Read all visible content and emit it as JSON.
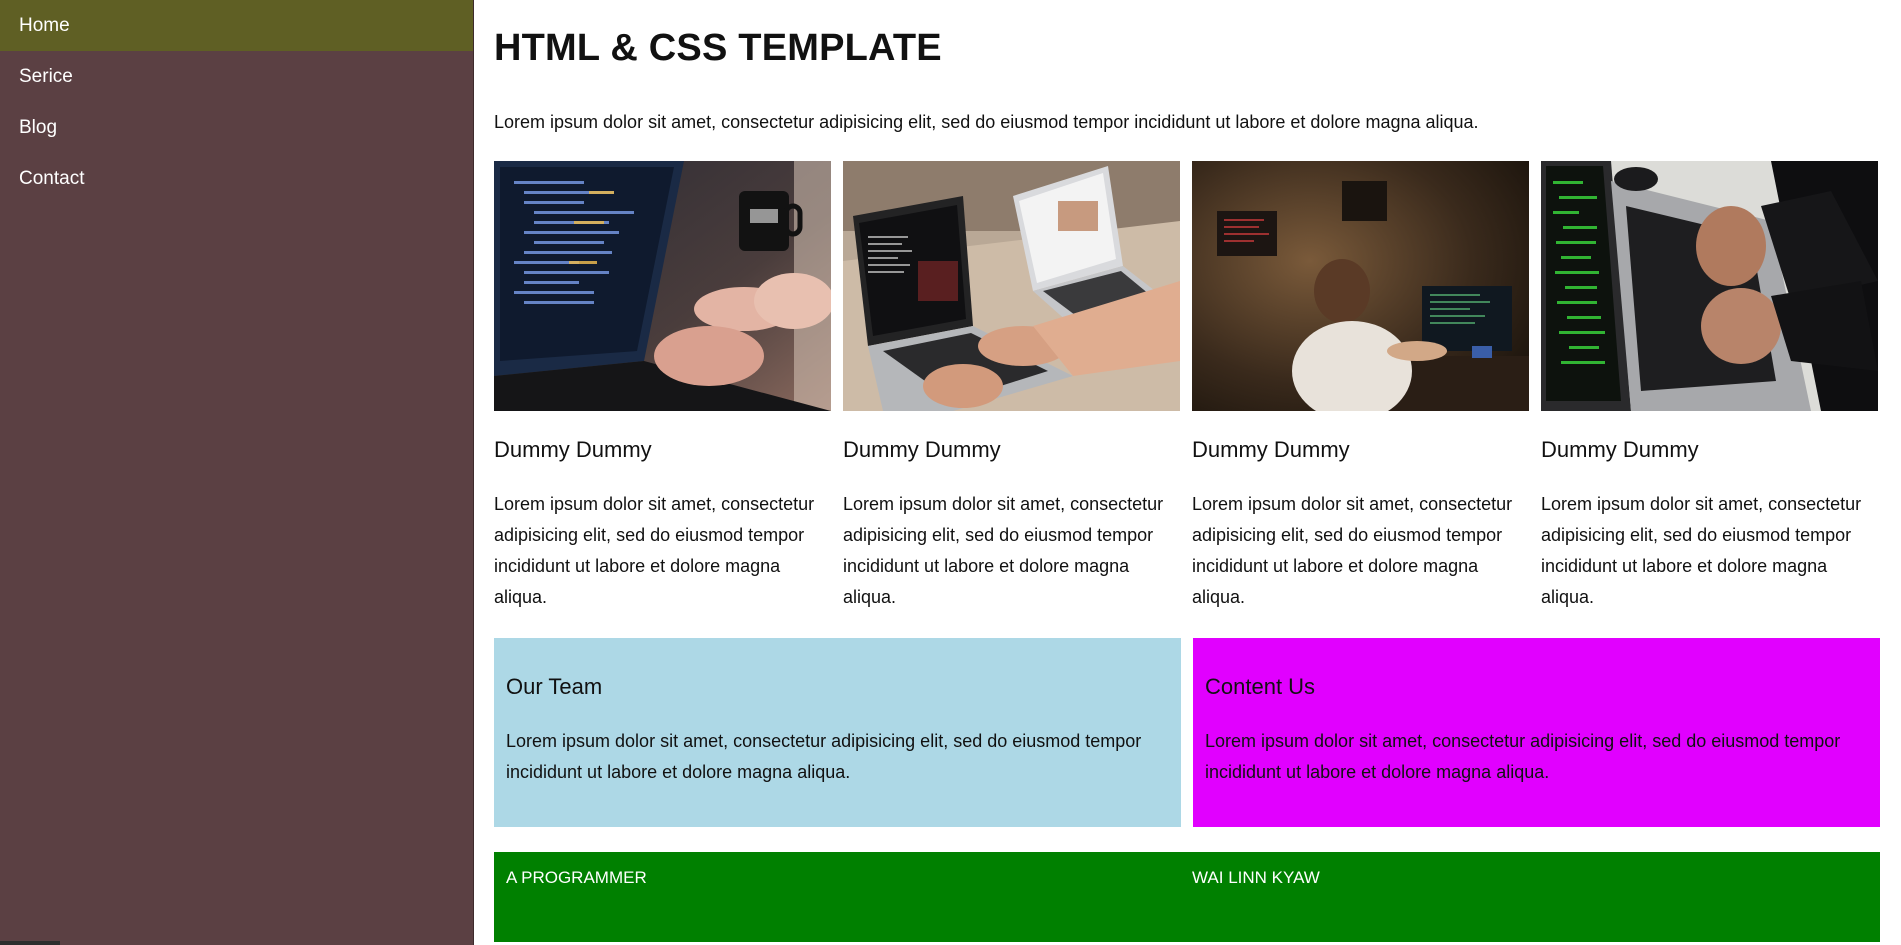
{
  "colors": {
    "sidebar_bg": "#5b4043",
    "sidebar_active_bg": "#5f5f24",
    "team_box_bg": "#add8e6",
    "contact_box_bg": "#e100ff",
    "footer_bg": "#008000"
  },
  "sidebar": {
    "items": [
      {
        "label": "Home",
        "active": true
      },
      {
        "label": "Serice",
        "active": false
      },
      {
        "label": "Blog",
        "active": false
      },
      {
        "label": "Contact",
        "active": false
      }
    ]
  },
  "main": {
    "title": "HTML & CSS TEMPLATE",
    "intro": "Lorem ipsum dolor sit amet, consectetur adipisicing elit, sed do eiusmod tempor incididunt ut labore et dolore magna aliqua.",
    "cards": [
      {
        "image": "laptop-code-coffee-photo",
        "title": "Dummy Dummy",
        "text": "Lorem ipsum dolor sit amet, consectetur adipisicing elit, sed do eiusmod tempor incididunt ut labore et dolore magna aliqua."
      },
      {
        "image": "two-laptops-desk-photo",
        "title": "Dummy Dummy",
        "text": "Lorem ipsum dolor sit amet, consectetur adipisicing elit, sed do eiusmod tempor incididunt ut labore et dolore magna aliqua."
      },
      {
        "image": "person-at-monitor-dark-room-photo",
        "title": "Dummy Dummy",
        "text": "Lorem ipsum dolor sit amet, consectetur adipisicing elit, sed do eiusmod tempor incididunt ut labore et dolore magna aliqua."
      },
      {
        "image": "hands-typing-green-code-photo",
        "title": "Dummy Dummy",
        "text": "Lorem ipsum dolor sit amet, consectetur adipisicing elit, sed do eiusmod tempor incididunt ut labore et dolore magna aliqua."
      }
    ],
    "team": {
      "title": "Our Team",
      "text": "Lorem ipsum dolor sit amet, consectetur adipisicing elit, sed do eiusmod tempor incididunt ut labore et dolore magna aliqua."
    },
    "contact": {
      "title": "Content Us",
      "text": "Lorem ipsum dolor sit amet, consectetur adipisicing elit, sed do eiusmod tempor incididunt ut labore et dolore magna aliqua."
    }
  },
  "footer": {
    "left": "A PROGRAMMER",
    "right": "WAI LINN KYAW"
  }
}
